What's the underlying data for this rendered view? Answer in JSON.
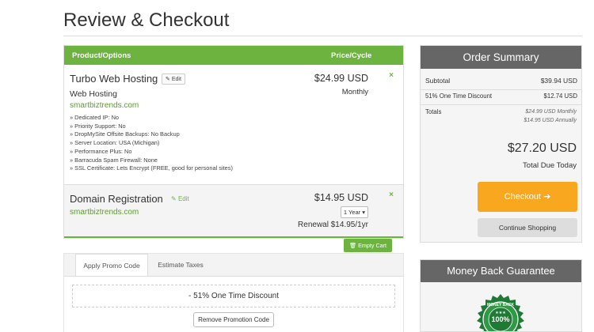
{
  "page": {
    "title": "Review & Checkout"
  },
  "cart": {
    "header": {
      "product_col": "Product/Options",
      "price_col": "Price/Cycle"
    },
    "items": [
      {
        "title": "Turbo Web Hosting",
        "edit_label": "Edit",
        "subtitle": "Web Hosting",
        "domain": "smartbiztrends.com",
        "options": [
          "» Dedicated IP: No",
          "» Priority Support: No",
          "» DropMySite Offsite Backups: No Backup",
          "» Server Location: USA (Michigan)",
          "» Performance Plus: No",
          "» Barracuda Spam Firewall: None",
          "» SSL Certificate: Lets Encrypt (FREE, good for personal sites)"
        ],
        "price": "$24.99 USD",
        "cycle": "Monthly",
        "remove": "×"
      },
      {
        "title": "Domain Registration",
        "edit_label": "Edit",
        "domain": "smartbiztrends.com",
        "price": "$14.95 USD",
        "period_select": "1 Year",
        "renewal": "Renewal $14.95/1yr",
        "remove": "×"
      }
    ],
    "empty_cart_label": "Empty Cart"
  },
  "promo": {
    "tabs": [
      "Apply Promo Code",
      "Estimate Taxes"
    ],
    "applied_discount": "- 51% One Time Discount",
    "remove_label": "Remove Promotion Code"
  },
  "summary": {
    "title": "Order Summary",
    "subtotal_label": "Subtotal",
    "subtotal_value": "$39.94 USD",
    "discount_label": "51% One Time Discount",
    "discount_value": "$12.74 USD",
    "totals_label": "Totals",
    "totals_monthly": "$24.99 USD Monthly",
    "totals_annually": "$14.95 USD Annually",
    "total_due": "$27.20 USD",
    "total_due_label": "Total Due Today",
    "checkout_label": "Checkout",
    "checkout_icon": "arrow-right-icon",
    "continue_label": "Continue Shopping"
  },
  "guarantee": {
    "title": "Money Back Guarantee",
    "badge_text": "100%",
    "badge_ring_text": "MONEY BACK"
  },
  "colors": {
    "brand_green": "#6cb33f",
    "checkout_orange": "#f8a71e",
    "panel_header": "#666666"
  }
}
